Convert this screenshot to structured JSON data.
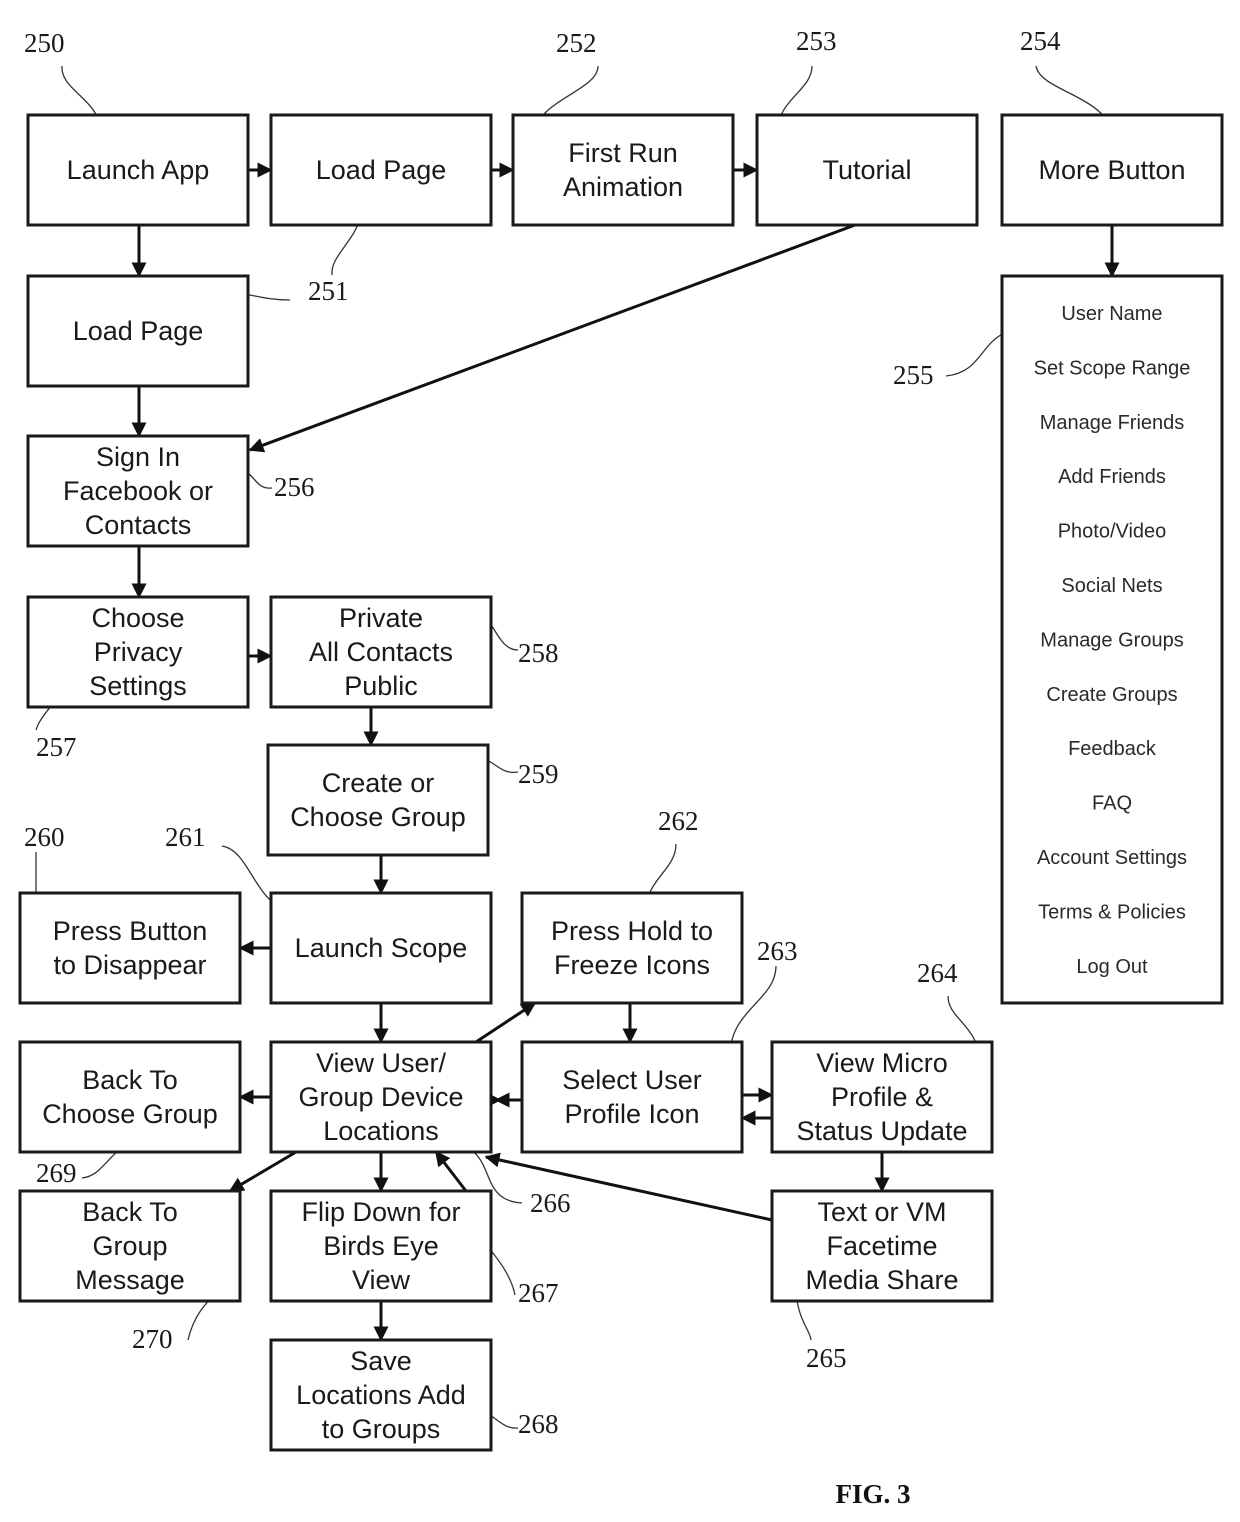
{
  "figure_label": "FIG. 3",
  "nodes": [
    {
      "id": "launch-app",
      "ref": "250",
      "lines": [
        "Launch App"
      ]
    },
    {
      "id": "load-page-a",
      "ref": "251",
      "lines": [
        "Load Page"
      ]
    },
    {
      "id": "first-run-animation",
      "ref": "252",
      "lines": [
        "First Run",
        "Animation"
      ]
    },
    {
      "id": "tutorial",
      "ref": "253",
      "lines": [
        "Tutorial"
      ]
    },
    {
      "id": "more-button",
      "ref": "254",
      "lines": [
        "More Button"
      ]
    },
    {
      "id": "load-page-b",
      "ref": "251",
      "lines": [
        "Load Page"
      ]
    },
    {
      "id": "sign-in",
      "ref": "256",
      "lines": [
        "Sign In",
        "Facebook or",
        "Contacts"
      ]
    },
    {
      "id": "choose-privacy",
      "ref": "257",
      "lines": [
        "Choose",
        "Privacy",
        "Settings"
      ]
    },
    {
      "id": "privacy-options",
      "ref": "258",
      "lines": [
        "Private",
        "All Contacts",
        "Public"
      ]
    },
    {
      "id": "create-choose-group",
      "ref": "259",
      "lines": [
        "Create or",
        "Choose Group"
      ]
    },
    {
      "id": "press-button-disappear",
      "ref": "260",
      "lines": [
        "Press Button",
        "to Disappear"
      ]
    },
    {
      "id": "launch-scope",
      "ref": "261",
      "lines": [
        "Launch Scope"
      ]
    },
    {
      "id": "press-hold-freeze",
      "ref": "262",
      "lines": [
        "Press Hold to",
        "Freeze Icons"
      ]
    },
    {
      "id": "back-to-choose-group",
      "ref": "269",
      "lines": [
        "Back To",
        "Choose Group"
      ]
    },
    {
      "id": "view-locations",
      "ref": "266",
      "lines": [
        "View  User/",
        "Group Device",
        "Locations"
      ]
    },
    {
      "id": "select-profile-icon",
      "ref": "263",
      "lines": [
        "Select User",
        "Profile Icon"
      ]
    },
    {
      "id": "view-micro-profile",
      "ref": "264",
      "lines": [
        "View Micro",
        "Profile &",
        "Status Update"
      ]
    },
    {
      "id": "back-to-group-message",
      "ref": "270",
      "lines": [
        "Back To",
        "Group",
        "Message"
      ]
    },
    {
      "id": "flip-down",
      "ref": "267",
      "lines": [
        "Flip Down for",
        "Birds Eye",
        "View"
      ]
    },
    {
      "id": "text-vm-facetime",
      "ref": "265",
      "lines": [
        "Text or VM",
        "Facetime",
        "Media Share"
      ]
    },
    {
      "id": "save-locations",
      "ref": "268",
      "lines": [
        "Save",
        "Locations Add",
        "to Groups"
      ]
    }
  ],
  "more_menu": {
    "ref": "255",
    "items": [
      "User Name",
      "Set Scope Range",
      "Manage Friends",
      "Add Friends",
      "Photo/Video",
      "Social Nets",
      "Manage Groups",
      "Create Groups",
      "Feedback",
      "FAQ",
      "Account Settings",
      "Terms & Policies",
      "Log Out"
    ]
  },
  "edges": [
    {
      "from": "launch-app",
      "to": "load-page-a"
    },
    {
      "from": "load-page-a",
      "to": "first-run-animation"
    },
    {
      "from": "first-run-animation",
      "to": "tutorial"
    },
    {
      "from": "launch-app",
      "to": "load-page-b"
    },
    {
      "from": "tutorial",
      "to": "sign-in"
    },
    {
      "from": "more-button",
      "to": "more-menu"
    },
    {
      "from": "load-page-b",
      "to": "sign-in"
    },
    {
      "from": "sign-in",
      "to": "choose-privacy"
    },
    {
      "from": "choose-privacy",
      "to": "privacy-options"
    },
    {
      "from": "privacy-options",
      "to": "create-choose-group"
    },
    {
      "from": "create-choose-group",
      "to": "launch-scope"
    },
    {
      "from": "launch-scope",
      "to": "press-button-disappear"
    },
    {
      "from": "launch-scope",
      "to": "view-locations"
    },
    {
      "from": "view-locations",
      "to": "press-hold-freeze"
    },
    {
      "from": "press-hold-freeze",
      "to": "select-profile-icon"
    },
    {
      "from": "view-locations",
      "to": "back-to-choose-group"
    },
    {
      "from": "view-locations",
      "to": "select-profile-icon"
    },
    {
      "from": "select-profile-icon",
      "to": "view-locations"
    },
    {
      "from": "select-profile-icon",
      "to": "view-micro-profile"
    },
    {
      "from": "view-micro-profile",
      "to": "select-profile-icon"
    },
    {
      "from": "view-micro-profile",
      "to": "text-vm-facetime"
    },
    {
      "from": "text-vm-facetime",
      "to": "view-locations"
    },
    {
      "from": "view-locations",
      "to": "back-to-group-message"
    },
    {
      "from": "view-locations",
      "to": "flip-down"
    },
    {
      "from": "flip-down",
      "to": "view-locations"
    },
    {
      "from": "flip-down",
      "to": "save-locations"
    }
  ]
}
